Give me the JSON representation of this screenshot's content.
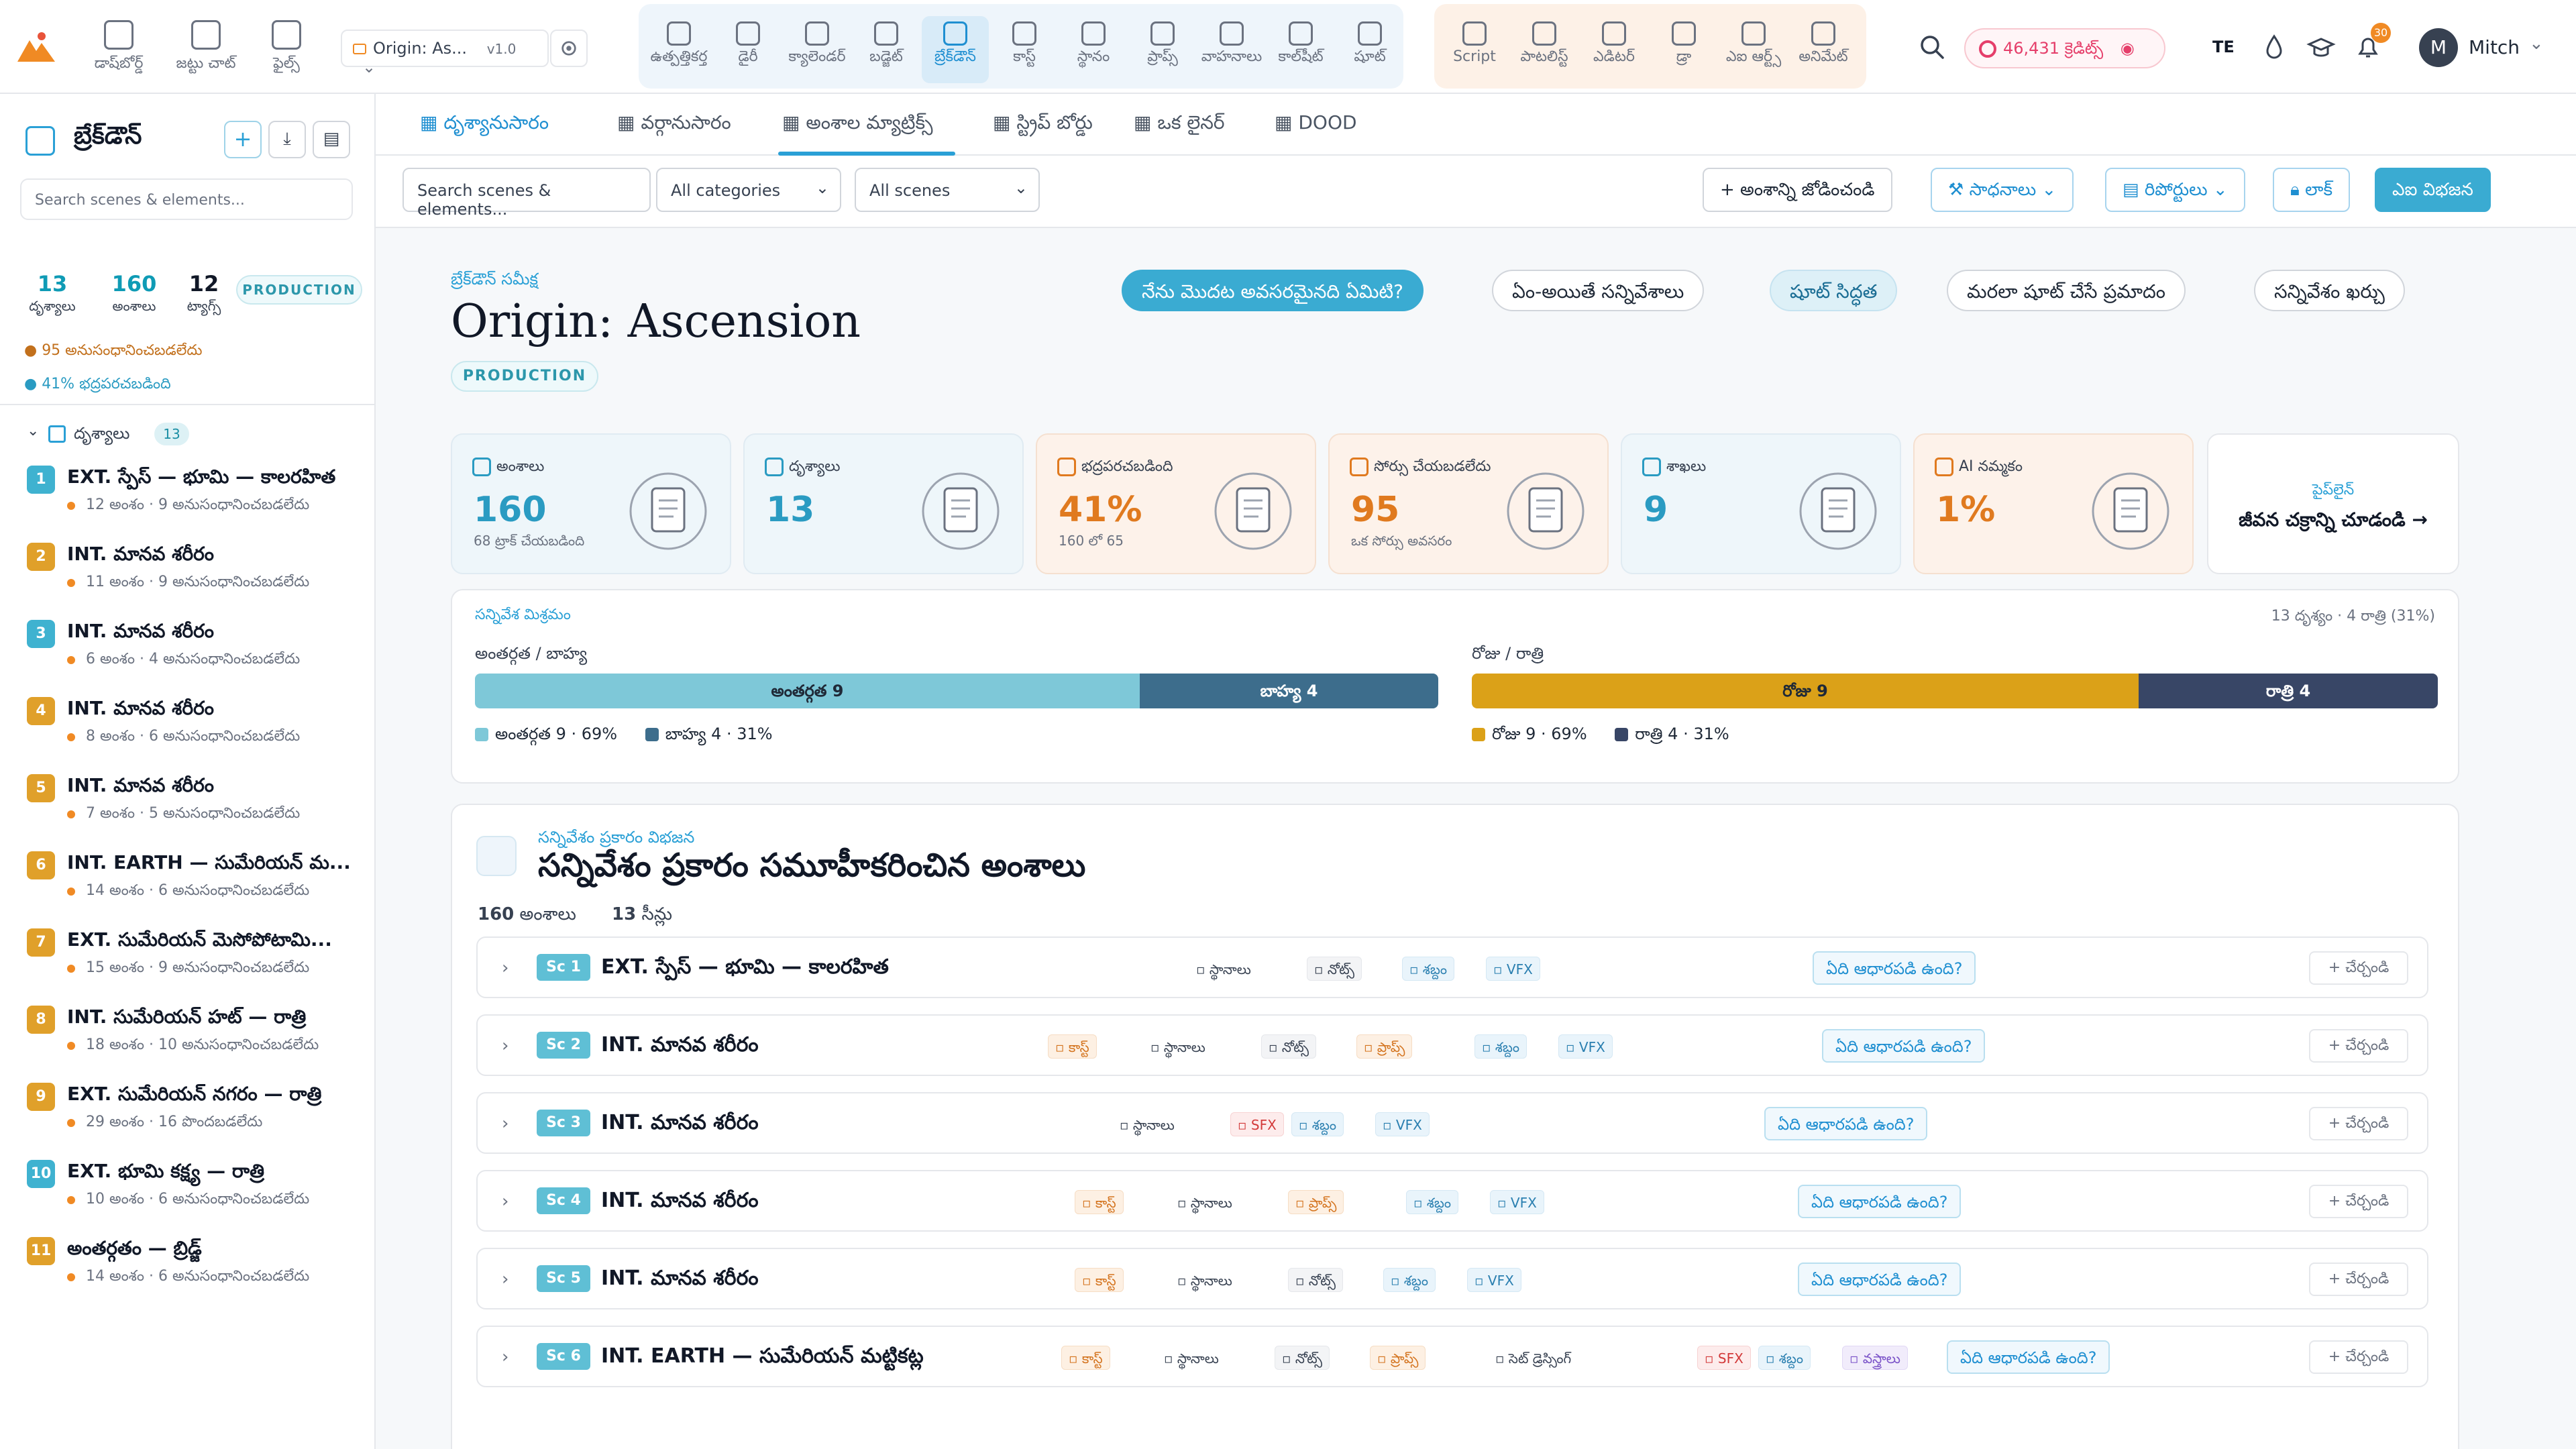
{
  "topbar": {
    "nav": [
      {
        "label": "డాష్‌బోర్డ్",
        "icon": "grid-icon"
      },
      {
        "label": "జట్టు చాట్",
        "icon": "chat-icon"
      },
      {
        "label": "ఫైల్స్",
        "icon": "folder-icon"
      }
    ],
    "project_name": "Origin: As...",
    "project_version": "v1.0",
    "tools_main": [
      {
        "label": "ఉత్పత్తికర్త",
        "icon": "film-icon"
      },
      {
        "label": "డైరీ",
        "icon": "doc-icon"
      },
      {
        "label": "క్యాలెండర్",
        "icon": "calendar-icon"
      },
      {
        "label": "బడ్జెట్",
        "icon": "dollar-icon"
      },
      {
        "label": "బ్రేక్‌డౌన్",
        "icon": "layers-icon",
        "active": true
      },
      {
        "label": "కాస్ట్",
        "icon": "users-icon"
      },
      {
        "label": "స్థానం",
        "icon": "pin-icon"
      },
      {
        "label": "ప్రాప్స్",
        "icon": "box-icon"
      },
      {
        "label": "వాహనాలు",
        "icon": "truck-icon"
      },
      {
        "label": "కాల్‌షీట్",
        "icon": "clipboard-icon"
      },
      {
        "label": "షూట్",
        "icon": "camera-icon"
      }
    ],
    "tools_edit": [
      {
        "label": "Script",
        "icon": "script-icon"
      },
      {
        "label": "పాటలిస్ట్",
        "icon": "list-icon"
      },
      {
        "label": "ఎడిటర్",
        "icon": "editor-icon"
      },
      {
        "label": "డ్రా",
        "icon": "pencil-icon"
      },
      {
        "label": "ఎఐ ఆర్ట్స్",
        "icon": "eye-icon"
      },
      {
        "label": "అనిమేట్",
        "icon": "play-icon"
      }
    ],
    "credits": "46,431 క్రెడిట్స్",
    "lang": "TE",
    "notif_count": "30",
    "user_initial": "M",
    "user_name": "Mitch"
  },
  "sidebar": {
    "title": "బ్రేక్‌డౌన్",
    "search_placeholder": "Search scenes & elements...",
    "stats": [
      {
        "value": "13",
        "label": "దృశ్యాలు"
      },
      {
        "value": "160",
        "label": "అంశాలు"
      },
      {
        "value": "12",
        "label": "ట్యాగ్స్"
      }
    ],
    "badge": "PRODUCTION",
    "note_unlinked": "● 95 అనుసంధానించబడలేదు",
    "note_secured": "● 41% భద్రపరచబడింది",
    "scenes_header": "దృశ్యాలు",
    "scenes_count": "13",
    "scenes": [
      {
        "num": "1",
        "title": "EXT. స్పేస్ — భూమి — కాలరహిత",
        "sub": "12 అంశం · 9 అనుసంధానించబడలేదు",
        "color": "#3fb2d0"
      },
      {
        "num": "2",
        "title": "INT. మానవ శరీరం",
        "sub": "11 అంశం · 9 అనుసంధానించబడలేదు",
        "color": "#e0a02a"
      },
      {
        "num": "3",
        "title": "INT. మానవ శరీరం",
        "sub": "6 అంశం · 4 అనుసంధానించబడలేదు",
        "color": "#3fb2d0"
      },
      {
        "num": "4",
        "title": "INT. మానవ శరీరం",
        "sub": "8 అంశం · 6 అనుసంధానించబడలేదు",
        "color": "#e0a02a"
      },
      {
        "num": "5",
        "title": "INT. మానవ శరీరం",
        "sub": "7 అంశం · 5 అనుసంధానించబడలేదు",
        "color": "#e0a02a"
      },
      {
        "num": "6",
        "title": "INT. EARTH — సుమేరియన్ మ...",
        "sub": "14 అంశం · 6 అనుసంధానించబడలేదు",
        "color": "#e0a02a"
      },
      {
        "num": "7",
        "title": "EXT. సుమేరియన్ మెసోపోటామి...",
        "sub": "15 అంశం · 9 అనుసంధానించబడలేదు",
        "color": "#e0a02a"
      },
      {
        "num": "8",
        "title": "INT. సుమేరియన్ హట్ — రాత్రి",
        "sub": "18 అంశం · 10 అనుసంధానించబడలేదు",
        "color": "#e0a02a"
      },
      {
        "num": "9",
        "title": "EXT. సుమేరియన్ నగరం — రాత్రి",
        "sub": "29 అంశం · 16 పొందబడలేదు",
        "color": "#e0a02a"
      },
      {
        "num": "10",
        "title": "EXT. భూమి కక్ష్య — రాత్రి",
        "sub": "10 అంశం · 6 అనుసంధానించబడలేదు",
        "color": "#3fb2d0"
      },
      {
        "num": "11",
        "title": "అంతర్గతం — బ్రిడ్జ్",
        "sub": "14 అంశం · 6 అనుసంధానించబడలేదు",
        "color": "#e0a02a"
      }
    ]
  },
  "tabs": [
    {
      "label": "దృశ్యానుసారం",
      "active": true
    },
    {
      "label": "వర్గానుసారం"
    },
    {
      "label": "అంశాల మ్యాట్రిక్స్"
    },
    {
      "label": "స్ట్రిప్ బోర్డు"
    },
    {
      "label": "ఒక లైనర్"
    },
    {
      "label": "DOOD"
    }
  ],
  "filters": {
    "search_placeholder": "Search scenes & elements...",
    "category": "All categories",
    "scenes": "All scenes",
    "add_element": "+ అంశాన్ని జోడించండి",
    "tools": "సాధనాలు",
    "reports": "రిపోర్టులు",
    "lock": "లాక్",
    "ai_breakdown": "ఎఐ విభజన"
  },
  "header": {
    "eyebrow": "బ్రేక్‌డౌన్ సమీక్ష",
    "title": "Origin: Ascension",
    "badge": "PRODUCTION",
    "pills": [
      {
        "label": "నేను మొదట అవసరమైనది ఏమిటి?",
        "style": "primary"
      },
      {
        "label": "ఏం-అయితే సన్నివేశాలు",
        "style": "plain"
      },
      {
        "label": "షూట్ సిద్ధత",
        "style": "lightblue"
      },
      {
        "label": "మరలా షూట్ చేసే ప్రమాదం",
        "style": "plain"
      },
      {
        "label": "సన్నివేశం ఖర్చు",
        "style": "plain"
      }
    ]
  },
  "kpis": [
    {
      "label": "అంశాలు",
      "value": "160",
      "sub": "68 ట్రాక్ చేయబడింది",
      "warm": false,
      "icon": "users-icon"
    },
    {
      "label": "దృశ్యాలు",
      "value": "13",
      "sub": "",
      "warm": false,
      "icon": "film-icon"
    },
    {
      "label": "భద్రపరచబడింది",
      "value": "41%",
      "sub": "160 లో 65",
      "warm": true,
      "icon": "shield-icon"
    },
    {
      "label": "సోర్సు చేయబడలేదు",
      "value": "95",
      "sub": "ఒక సోర్సు అవసరం",
      "warm": true,
      "icon": "search-icon"
    },
    {
      "label": "శాఖలు",
      "value": "9",
      "sub": "",
      "warm": false,
      "icon": "layers-icon"
    },
    {
      "label": "AI నమ్మకం",
      "value": "1%",
      "sub": "",
      "warm": true,
      "icon": "sparkle-icon"
    }
  ],
  "pipeline": {
    "eyebrow": "పైప్‌లైన్",
    "label": "జీవన చక్రాన్ని చూడండి →"
  },
  "mix": {
    "eyebrow": "సన్నివేశ మిశ్రమం",
    "right": "13 దృశ్యం · 4 రాత్రి (31%)",
    "ie_label": "అంతర్గత / బాహ్య",
    "int_label": "అంతర్గత 9",
    "ext_label": "బాహ్య 4",
    "int_frac": 0.69,
    "int_legend": "అంతర్గత 9 · 69%",
    "ext_legend": "బాహ్య 4 · 31%",
    "dn_label": "రోజు / రాత్రి",
    "day_label": "రోజు 9",
    "night_label": "రాత్రి 4",
    "day_frac": 0.69,
    "day_legend": "రోజు 9 · 69%",
    "night_legend": "రాత్రి 4 · 31%",
    "colors": {
      "int": "#7ec8d8",
      "ext": "#3d6d8c",
      "day": "#dba118",
      "night": "#384666"
    }
  },
  "groups": {
    "eyebrow": "సన్నివేశం ప్రకారం విభజన",
    "title": "సన్నివేశం ప్రకారం సమూహీకరించిన అంశాలు",
    "count_elements": "160",
    "count_elements_label": "అంశాలు",
    "count_scenes": "13",
    "count_scenes_label": "సీన్లు",
    "what_label": "ఏది ఆధారపడి ఉంది?",
    "add_label": "+ చేర్చండి",
    "rows": [
      {
        "sc": "Sc 1",
        "title": "EXT. స్పేస్ — భూమి — కాలరహిత",
        "chips": [
          {
            "t": "స్థానాలు",
            "c": "plain"
          },
          {
            "t": "నోట్స్",
            "c": "grey"
          },
          {
            "t": "శబ్దం",
            "c": "blue"
          },
          {
            "t": "VFX",
            "c": "blue"
          }
        ]
      },
      {
        "sc": "Sc 2",
        "title": "INT. మానవ శరీరం",
        "chips": [
          {
            "t": "కాస్ట్",
            "c": "orange"
          },
          {
            "t": "స్థానాలు",
            "c": "plain"
          },
          {
            "t": "నోట్స్",
            "c": "grey"
          },
          {
            "t": "ప్రాప్స్",
            "c": "orange"
          },
          {
            "t": "శబ్దం",
            "c": "blue"
          },
          {
            "t": "VFX",
            "c": "blue"
          }
        ]
      },
      {
        "sc": "Sc 3",
        "title": "INT. మానవ శరీరం",
        "chips": [
          {
            "t": "స్థానాలు",
            "c": "plain"
          },
          {
            "t": "SFX",
            "c": "red"
          },
          {
            "t": "శబ్దం",
            "c": "blue"
          },
          {
            "t": "VFX",
            "c": "blue"
          }
        ]
      },
      {
        "sc": "Sc 4",
        "title": "INT. మానవ శరీరం",
        "chips": [
          {
            "t": "కాస్ట్",
            "c": "orange"
          },
          {
            "t": "స్థానాలు",
            "c": "plain"
          },
          {
            "t": "ప్రాప్స్",
            "c": "orange"
          },
          {
            "t": "శబ్దం",
            "c": "blue"
          },
          {
            "t": "VFX",
            "c": "blue"
          }
        ]
      },
      {
        "sc": "Sc 5",
        "title": "INT. మానవ శరీరం",
        "chips": [
          {
            "t": "కాస్ట్",
            "c": "orange"
          },
          {
            "t": "స్థానాలు",
            "c": "plain"
          },
          {
            "t": "నోట్స్",
            "c": "grey"
          },
          {
            "t": "శబ్దం",
            "c": "blue"
          },
          {
            "t": "VFX",
            "c": "blue"
          }
        ]
      },
      {
        "sc": "Sc 6",
        "title": "INT. EARTH — సుమేరియన్ మట్టికట్ల",
        "chips": [
          {
            "t": "కాస్ట్",
            "c": "orange"
          },
          {
            "t": "స్థానాలు",
            "c": "plain"
          },
          {
            "t": "నోట్స్",
            "c": "grey"
          },
          {
            "t": "ప్రాప్స్",
            "c": "orange"
          },
          {
            "t": "సెట్ డ్రెస్సింగ్",
            "c": "plain"
          },
          {
            "t": "SFX",
            "c": "red"
          },
          {
            "t": "శబ్దం",
            "c": "blue"
          },
          {
            "t": "వస్త్రాలు",
            "c": "purple"
          }
        ]
      }
    ]
  }
}
